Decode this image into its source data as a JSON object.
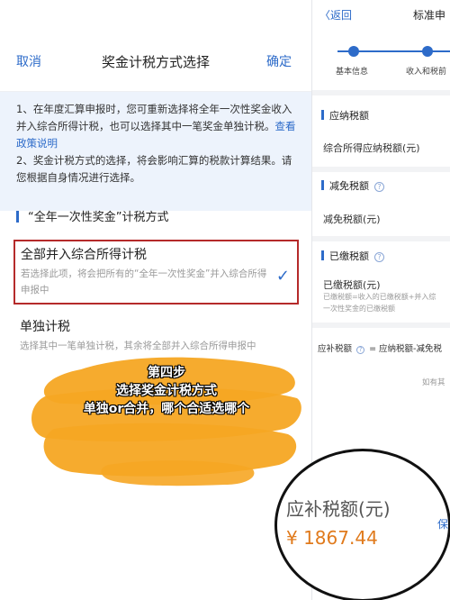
{
  "modal": {
    "cancel": "取消",
    "title": "奖金计税方式选择",
    "confirm": "确定"
  },
  "notice": {
    "line1": "1、在年度汇算申报时，您可重新选择将全年一次性奖金收入并入综合所得计税，也可以选择其中一笔奖金单独计税。",
    "link": "查看政策说明",
    "line2": "2、奖金计税方式的选择，将会影响汇算的税款计算结果。请您根据自身情况进行选择。"
  },
  "section_title": "“全年一次性奖金”计税方式",
  "options": [
    {
      "title": "全部并入综合所得计税",
      "desc": "若选择此项，将会把所有的“全年一次性奖金”并入综合所得申报中",
      "selected": true
    },
    {
      "title": "单独计税",
      "desc": "选择其中一笔单独计税，其余将全部并入综合所得申报中",
      "selected": false
    }
  ],
  "right": {
    "back": "〈返回",
    "title": "标准申",
    "steps": [
      "基本信息",
      "收入和税前"
    ],
    "payable_title": "应纳税额",
    "payable_row": "综合所得应纳税额(元)",
    "reduce_title": "减免税额",
    "reduce_row": "减免税额(元)",
    "paid_title": "已缴税额",
    "paid_row": "已缴税额(元)",
    "paid_note1": "已缴税额=收入的已缴税额+并入综",
    "paid_note2": "一次性奖金的已缴税额",
    "formula_a": "应补税额",
    "formula_b": "= 应纳税额-减免税",
    "hint": "如有其",
    "save": "保"
  },
  "annotation": {
    "line1": "第四步",
    "line2": "选择奖金计税方式",
    "line3": "单独or合并，哪个合适选哪个"
  },
  "magnifier": {
    "label": "应补税额(元)",
    "value": "¥ 1867.44",
    "save": "保"
  },
  "colors": {
    "accent": "#2d6bc9",
    "highlight_border": "#b52a2a",
    "amount": "#e07a1c",
    "brush": "#f6a623"
  }
}
